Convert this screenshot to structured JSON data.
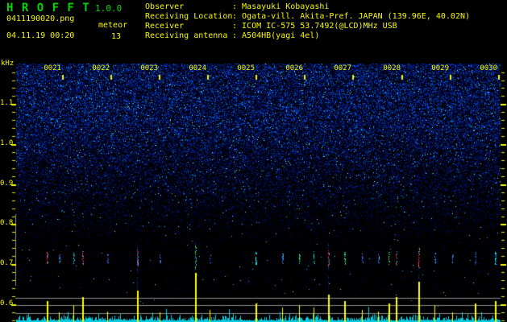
{
  "header": {
    "app_title": "H R O F F T",
    "version": "1.0.0",
    "filename": "0411190020.png",
    "mode": "meteor",
    "datetime": "04.11.19 00:20",
    "count": "13",
    "info_rows": [
      {
        "label": "Observer",
        "value": ": Masayuki Kobayashi"
      },
      {
        "label": "Receiving Location",
        "value": ": Ogata-vill. Akita-Pref. JAPAN (139.96E, 40.02N)"
      },
      {
        "label": "Receiver",
        "value": ": ICOM IC-575 53.7492(@LCD)MHz USB"
      },
      {
        "label": "Receiving antenna",
        "value": ": A504HB(yagi 4el)"
      }
    ]
  },
  "chart_data": {
    "type": "heatmap",
    "subtype": "radio-meteor-spectrogram",
    "ylabel": "kHz",
    "y_tick_labels": [
      "1.1",
      "1.0",
      "0.9",
      "0.8",
      "0.7",
      "0.6"
    ],
    "y_khz_per_div": 0.1,
    "x_tick_labels": [
      "0021",
      "0022",
      "0023",
      "0024",
      "0025",
      "0026",
      "0027",
      "0028",
      "0029",
      "0030"
    ],
    "x_minutes_per_div": 1,
    "carrier_band_khz": 0.7,
    "level_grid_lines": 3,
    "echo_events": [
      {
        "t_min": 0.67,
        "color": "red",
        "strength": 0.35
      },
      {
        "t_min": 0.92,
        "color": "blue",
        "strength": 0.1
      },
      {
        "t_min": 1.22,
        "color": "cyan",
        "strength": 0.25
      },
      {
        "t_min": 1.4,
        "color": "red",
        "strength": 0.45
      },
      {
        "t_min": 1.92,
        "color": "blue",
        "strength": 0.12
      },
      {
        "t_min": 2.53,
        "color": "magenta",
        "strength": 0.6
      },
      {
        "t_min": 3.0,
        "color": "blue",
        "strength": 0.1
      },
      {
        "t_min": 3.73,
        "color": "green",
        "strength": 1.0
      },
      {
        "t_min": 4.03,
        "color": "blue",
        "strength": 0.15
      },
      {
        "t_min": 4.98,
        "color": "cyan",
        "strength": 0.3
      },
      {
        "t_min": 5.53,
        "color": "blue",
        "strength": 0.2
      },
      {
        "t_min": 5.87,
        "color": "green",
        "strength": 0.25
      },
      {
        "t_min": 6.17,
        "color": "cyan",
        "strength": 0.2
      },
      {
        "t_min": 6.47,
        "color": "red",
        "strength": 0.5
      },
      {
        "t_min": 6.8,
        "color": "green",
        "strength": 0.35
      },
      {
        "t_min": 7.17,
        "color": "blue",
        "strength": 0.15
      },
      {
        "t_min": 7.5,
        "color": "blue",
        "strength": 0.12
      },
      {
        "t_min": 7.72,
        "color": "green",
        "strength": 0.3
      },
      {
        "t_min": 7.87,
        "color": "red",
        "strength": 0.45
      },
      {
        "t_min": 8.33,
        "color": "red",
        "strength": 0.8
      },
      {
        "t_min": 8.67,
        "color": "blue",
        "strength": 0.25
      },
      {
        "t_min": 9.03,
        "color": "blue",
        "strength": 0.1
      },
      {
        "t_min": 9.5,
        "color": "blue",
        "strength": 0.3
      },
      {
        "t_min": 9.92,
        "color": "cyan",
        "strength": 0.35
      }
    ]
  },
  "colors": {
    "background": "#000000",
    "title_green": "#00d800",
    "text_yellow": "#f8f800",
    "tick_yellow": "#e8e800",
    "axis_gray": "#8c8c8c",
    "noise_bright": "#8ceaff",
    "noise_cyan": "#00c8eb",
    "trace_cyan": "#00cde1",
    "spike_yellow": "#ffff00",
    "echo_red": "#ff2838",
    "echo_magenta": "#ff28a0",
    "echo_green": "#28e05a",
    "echo_cyan": "#00dce6",
    "echo_blue": "#3c64ff"
  }
}
